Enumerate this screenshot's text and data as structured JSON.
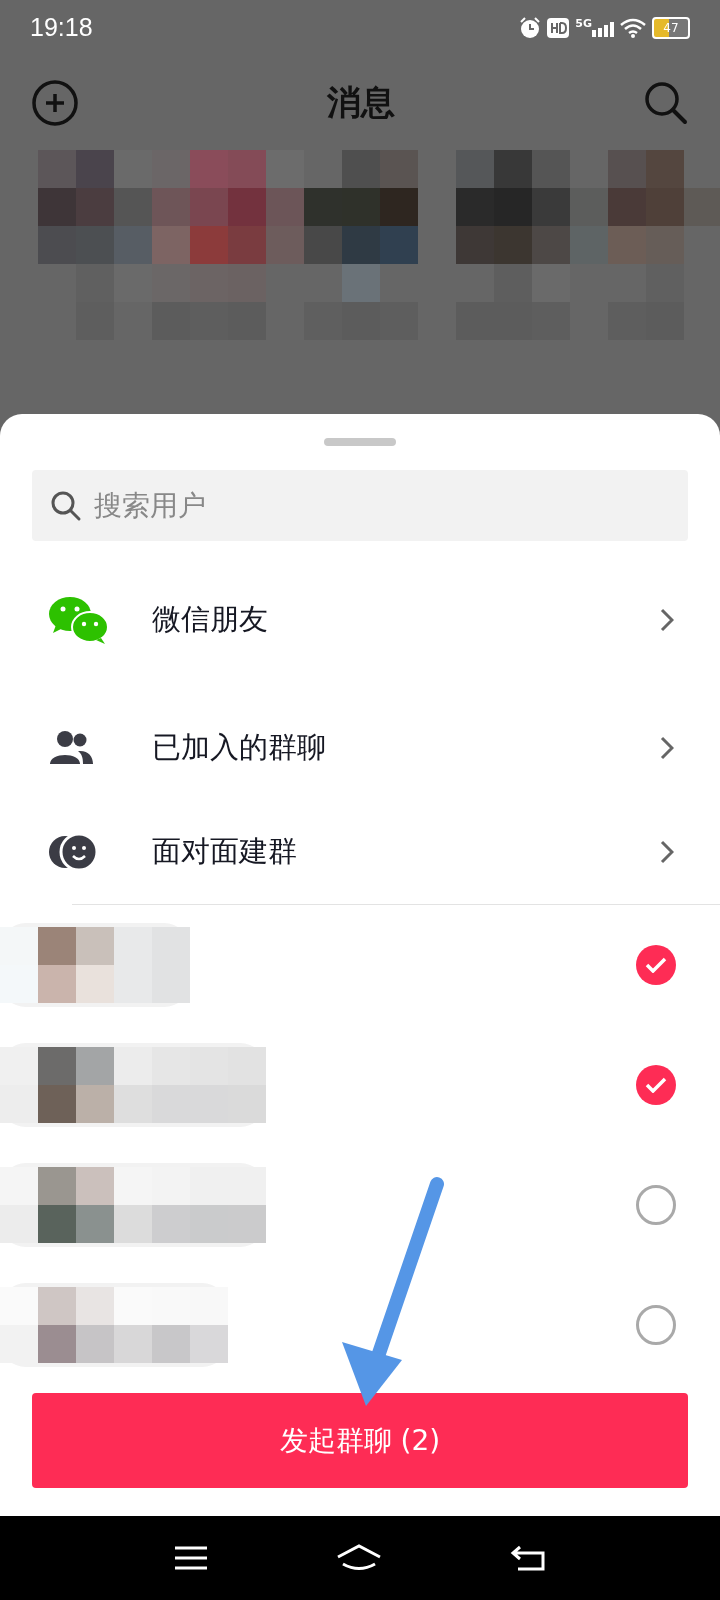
{
  "status_bar": {
    "time": "19:18",
    "network": "5G",
    "battery": "47"
  },
  "header": {
    "title": "消息"
  },
  "sheet": {
    "search": {
      "placeholder": "搜索用户"
    },
    "options": [
      {
        "kind": "wechat",
        "label": "微信朋友"
      },
      {
        "kind": "groups",
        "label": "已加入的群聊"
      },
      {
        "kind": "face",
        "label": "面对面建群"
      }
    ],
    "contacts": [
      {
        "selected": true
      },
      {
        "selected": true
      },
      {
        "selected": false
      },
      {
        "selected": false
      }
    ],
    "button": {
      "label": "发起群聊 (2)"
    }
  }
}
